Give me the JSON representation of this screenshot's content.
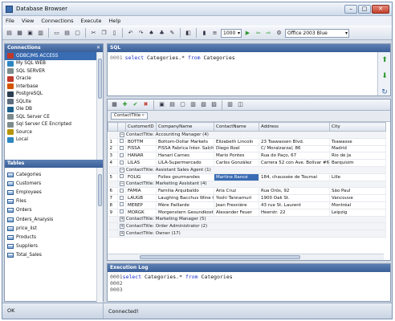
{
  "app": {
    "title": "Database Browser"
  },
  "window_controls": [
    "–",
    "□",
    "✕"
  ],
  "menu": [
    "File",
    "View",
    "Connections",
    "Execute",
    "Help"
  ],
  "toolbar": {
    "max_rows": "1000",
    "theme": "Office 2003 Blue",
    "icons": [
      "new-icon",
      "open-icon",
      "save-icon",
      "print-icon",
      "cut-icon",
      "copy-icon",
      "paste-icon",
      "find-icon",
      "replace-icon",
      "font-icon",
      "format-icon",
      "run-icon",
      "back-icon",
      "forward-icon"
    ]
  },
  "connections": {
    "header": "Connections",
    "items": [
      {
        "label": "ODBC/MS ACCESS",
        "color": "#c0392b"
      },
      {
        "label": "My SQL WEB",
        "color": "#2e86c1"
      },
      {
        "label": "SQL SERVER",
        "color": "#7f8c8d"
      },
      {
        "label": "Oracle",
        "color": "#c0392b"
      },
      {
        "label": "Interbase",
        "color": "#d35400"
      },
      {
        "label": "PostgreSQL",
        "color": "#2c3e50"
      },
      {
        "label": "SQLite",
        "color": "#5d6d7e"
      },
      {
        "label": "Ole DB",
        "color": "#1f618d"
      },
      {
        "label": "SQL Server CE",
        "color": "#7f8c8d"
      },
      {
        "label": "Sql Server CE Encripted",
        "color": "#7f8c8d"
      },
      {
        "label": "Source",
        "color": "#b7950b"
      },
      {
        "label": "Local",
        "color": "#2e86c1"
      }
    ],
    "selected_index": 0
  },
  "tables": {
    "header": "Tables",
    "items": [
      "Categories",
      "Customers",
      "Employees",
      "Files",
      "Orders",
      "Orders_Analysis",
      "price_list",
      "Products",
      "Suppliers",
      "Total_Sales"
    ]
  },
  "sql": {
    "header": "SQL",
    "line_no": "0001",
    "kw1": "select",
    "mid": " Categories.* ",
    "kw2": "from",
    "tail": " Categories"
  },
  "grid": {
    "group_field": "ContactTitle",
    "columns": [
      "",
      "",
      "CustomerID",
      "CompanyName",
      "ContactName",
      "Address",
      "City"
    ],
    "rows": [
      {
        "type": "group",
        "expanded": true,
        "label": "ContactTitle: Accounting Manager (4)"
      },
      {
        "type": "data",
        "num": "1",
        "id": "BOTTM",
        "company": "Bottom-Dollar Markets",
        "contact": "Elizabeth Lincoln",
        "address": "23 Tsawassen Blvd.",
        "city": "Tsawasse"
      },
      {
        "type": "data",
        "num": "2",
        "id": "FISSA",
        "company": "FISSA Fabrica Inter. Salchichas S.A.",
        "contact": "Diego Roel",
        "address": "C/ Moralzarzal, 86",
        "city": "Madrid"
      },
      {
        "type": "data",
        "num": "3",
        "id": "HANAR",
        "company": "Hanari Carnes",
        "contact": "Mario Pontes",
        "address": "Rua do Paço, 67",
        "city": "Rio de Ja"
      },
      {
        "type": "data",
        "num": "4",
        "id": "LILAS",
        "company": "LILA-Supermercado",
        "contact": "Carlos González",
        "address": "Carrera 52 con Ave. Bolívar #65-98 Llano Largo",
        "city": "Barquisim"
      },
      {
        "type": "group",
        "expanded": true,
        "label": "ContactTitle: Assistant Sales Agent (1)"
      },
      {
        "type": "data",
        "num": "5",
        "id": "FOLIG",
        "company": "Folies gourmandes",
        "contact": "Martine Rancé",
        "address": "184, chaussée de Tournai",
        "city": "Lille",
        "selected": true
      },
      {
        "type": "group",
        "expanded": true,
        "label": "ContactTitle: Marketing Assistant (4)"
      },
      {
        "type": "data",
        "num": "6",
        "id": "FAMIA",
        "company": "Familia Arquibaldo",
        "contact": "Aria Cruz",
        "address": "Rua Orós, 92",
        "city": "São Paul"
      },
      {
        "type": "data",
        "num": "7",
        "id": "LAUGB",
        "company": "Laughing Bacchus Wine Cellars",
        "contact": "Yoshi Tannamuri",
        "address": "1900 Oak St.",
        "city": "Vancouve"
      },
      {
        "type": "data",
        "num": "8",
        "id": "MEREP",
        "company": "Mère Paillarde",
        "contact": "Jean Fresnière",
        "address": "43 rue St. Laurent",
        "city": "Montréal"
      },
      {
        "type": "data",
        "num": "9",
        "id": "MORGK",
        "company": "Morgenstern Gesundkost",
        "contact": "Alexander Feuer",
        "address": "Heerstr. 22",
        "city": "Leipzig"
      },
      {
        "type": "group",
        "expanded": false,
        "label": "ContactTitle: Marketing Manager (5)"
      },
      {
        "type": "group",
        "expanded": false,
        "label": "ContactTitle: Order Administrator (2)"
      },
      {
        "type": "group",
        "expanded": false,
        "label": "ContactTitle: Owner (17)"
      }
    ]
  },
  "log": {
    "header": "Execution Log",
    "lines": [
      {
        "num": "0001",
        "kw1": "select",
        "mid": " Categories.* ",
        "kw2": "from",
        "tail": " Categories"
      },
      {
        "num": "0002"
      },
      {
        "num": "0003"
      }
    ]
  },
  "status": {
    "left": "OK",
    "right": "Connected!"
  },
  "colors": {
    "accent": "#3a6cb3",
    "panel_header": "#4a6ea6",
    "keyword": "#1c2fd0"
  }
}
